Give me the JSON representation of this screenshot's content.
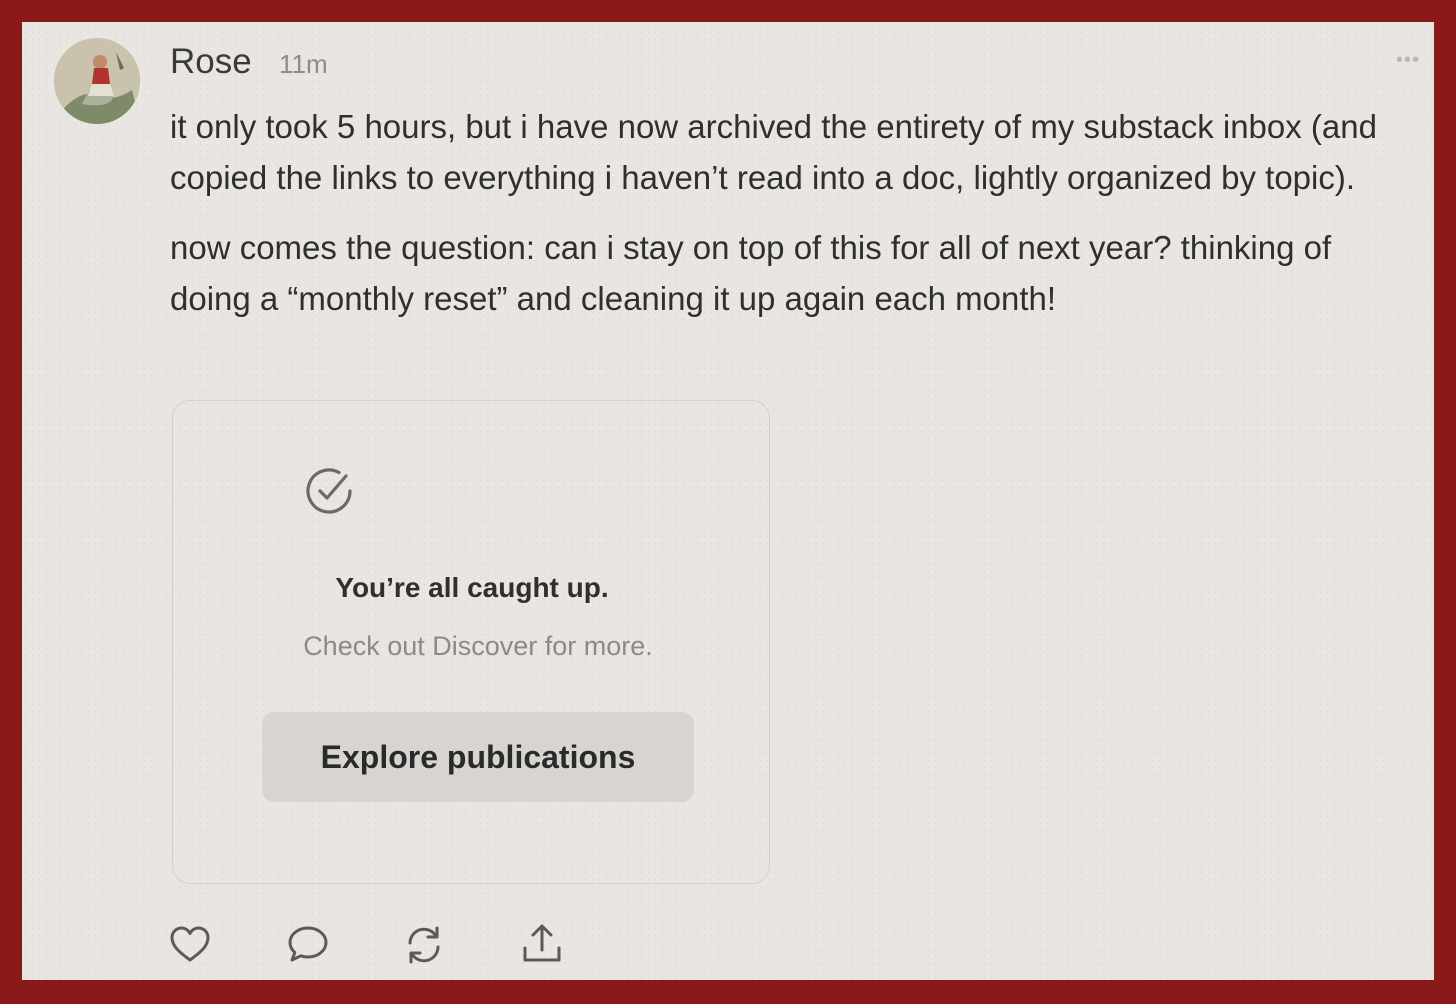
{
  "post": {
    "author": "Rose",
    "time": "11m",
    "paragraphs": [
      "it only took 5 hours, but i have now archived the entirety of my substack inbox (and copied the links to everything i haven’t read into a doc, lightly organized by topic).",
      "now comes the question: can i stay on top of this for all of next year? thinking of doing a “monthly reset” and cleaning it up again each month!"
    ]
  },
  "card": {
    "icon": "check-circle-icon",
    "title": "You’re all caught up.",
    "subtitle": "Check out Discover for more.",
    "button_label": "Explore publications"
  },
  "actions": [
    "heart-icon",
    "comment-icon",
    "restack-icon",
    "share-icon"
  ],
  "colors": {
    "border": "#8a1a1a",
    "background": "#e9e6e2",
    "text": "#2f2f2f",
    "muted": "#8a8a8a"
  }
}
